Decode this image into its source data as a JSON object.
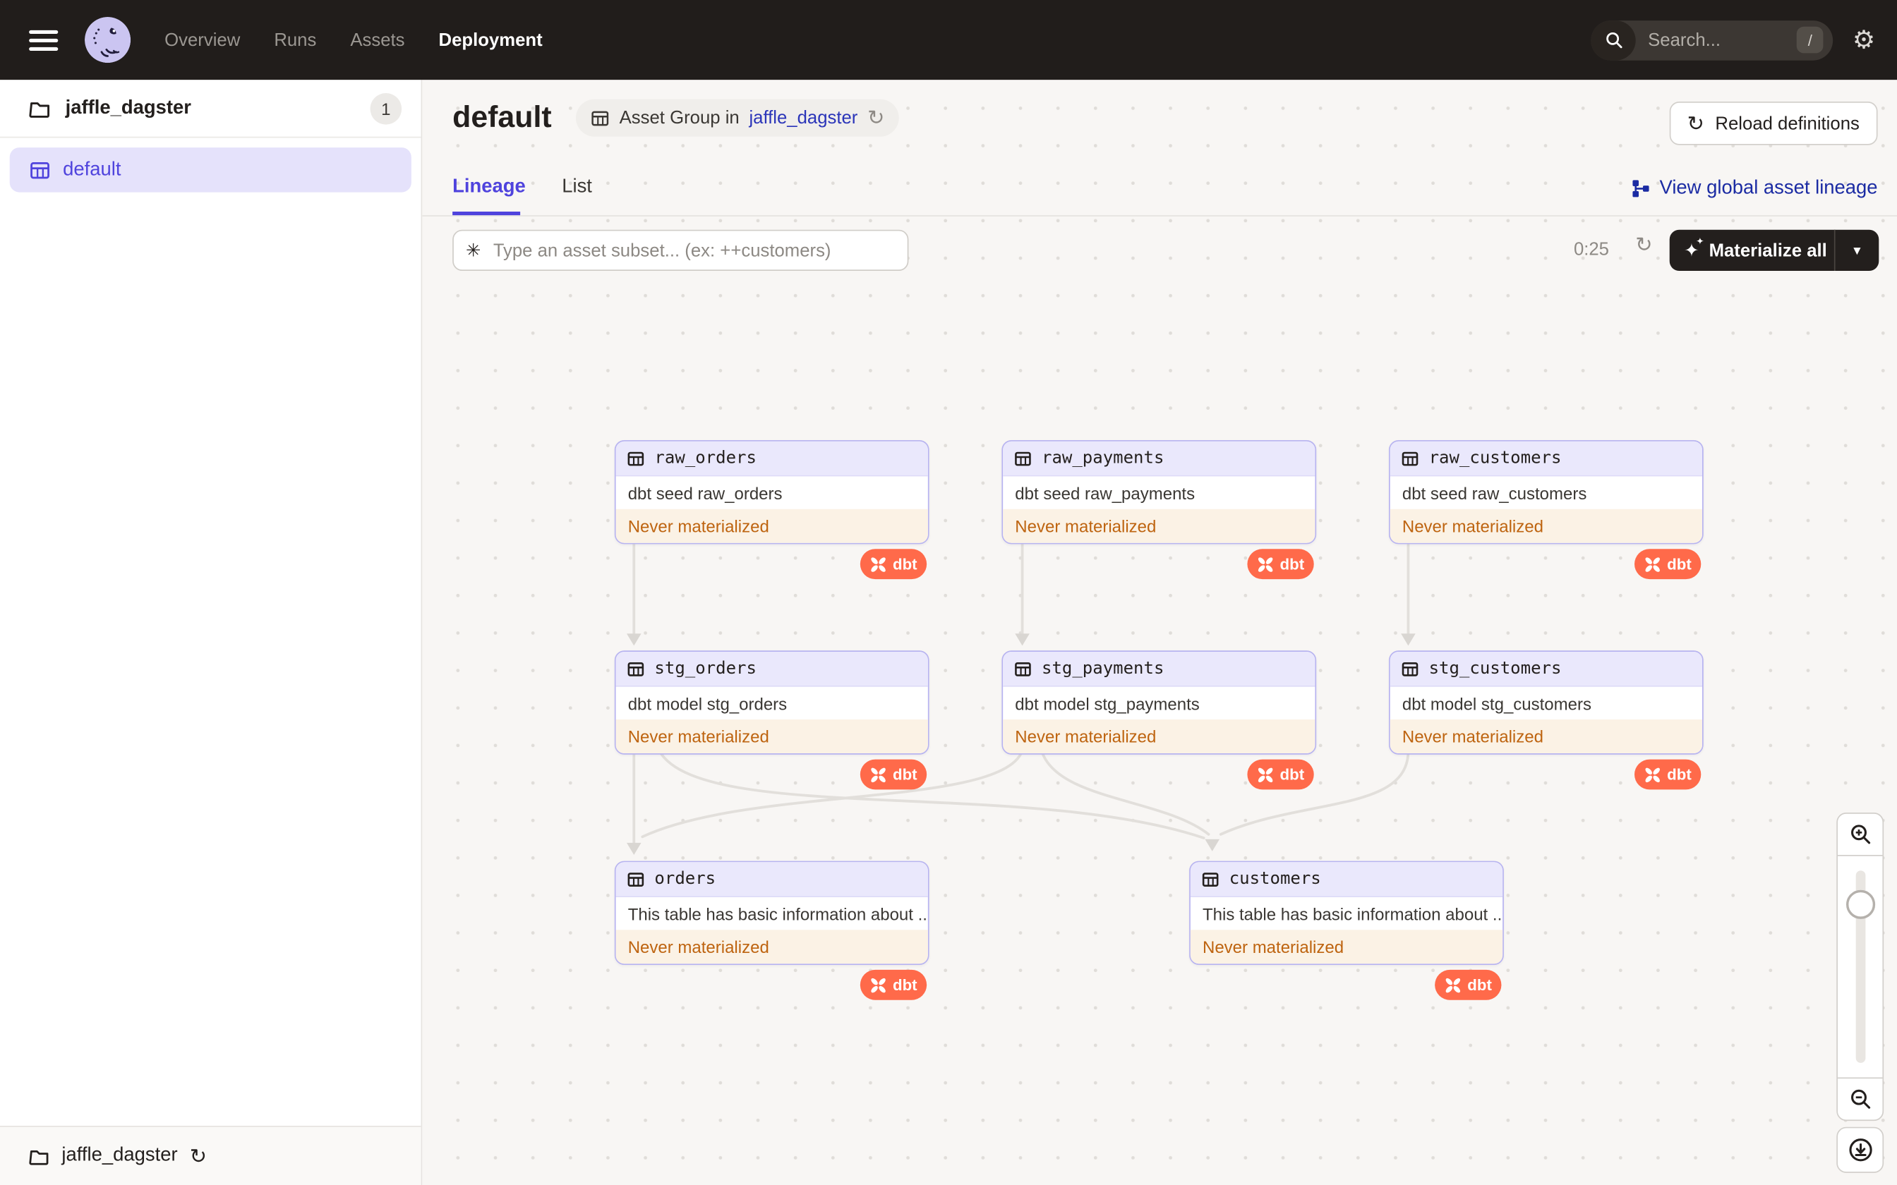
{
  "topbar": {
    "nav": [
      "Overview",
      "Runs",
      "Assets",
      "Deployment"
    ],
    "active_nav": "Deployment",
    "search": {
      "placeholder": "Search...",
      "shortcut": "/"
    }
  },
  "sidebar": {
    "project": {
      "name": "jaffle_dagster",
      "badge": "1"
    },
    "items": [
      {
        "label": "default",
        "selected": true
      }
    ],
    "footer": {
      "label": "jaffle_dagster"
    }
  },
  "header": {
    "title": "default",
    "group_badge": {
      "prefix": "Asset Group in",
      "link": "jaffle_dagster"
    },
    "reload_button": "Reload definitions"
  },
  "tabs": {
    "lineage": "Lineage",
    "list": "List"
  },
  "global_lineage_link": "View global asset lineage",
  "graph_toolbar": {
    "filter_placeholder": "Type an asset subset... (ex: ++customers)",
    "timer": "0:25",
    "materialize": "Materialize all"
  },
  "graph": {
    "nodes": [
      {
        "id": "raw_orders",
        "name": "raw_orders",
        "description": "dbt seed raw_orders",
        "status": "Never materialized",
        "badge": "dbt"
      },
      {
        "id": "raw_payments",
        "name": "raw_payments",
        "description": "dbt seed raw_payments",
        "status": "Never materialized",
        "badge": "dbt"
      },
      {
        "id": "raw_customers",
        "name": "raw_customers",
        "description": "dbt seed raw_customers",
        "status": "Never materialized",
        "badge": "dbt"
      },
      {
        "id": "stg_orders",
        "name": "stg_orders",
        "description": "dbt model stg_orders",
        "status": "Never materialized",
        "badge": "dbt"
      },
      {
        "id": "stg_payments",
        "name": "stg_payments",
        "description": "dbt model stg_payments",
        "status": "Never materialized",
        "badge": "dbt"
      },
      {
        "id": "stg_customers",
        "name": "stg_customers",
        "description": "dbt model stg_customers",
        "status": "Never materialized",
        "badge": "dbt"
      },
      {
        "id": "orders",
        "name": "orders",
        "description": "This table has basic information about ...",
        "status": "Never materialized",
        "badge": "dbt"
      },
      {
        "id": "customers",
        "name": "customers",
        "description": "This table has basic information about ...",
        "status": "Never materialized",
        "badge": "dbt"
      }
    ],
    "edges": [
      [
        "raw_orders",
        "stg_orders"
      ],
      [
        "raw_payments",
        "stg_payments"
      ],
      [
        "raw_customers",
        "stg_customers"
      ],
      [
        "stg_orders",
        "orders"
      ],
      [
        "stg_payments",
        "orders"
      ],
      [
        "stg_orders",
        "customers"
      ],
      [
        "stg_payments",
        "customers"
      ],
      [
        "stg_customers",
        "customers"
      ]
    ]
  },
  "icons": {
    "refresh_glyph": "↻",
    "caret_glyph": "▾",
    "sparkle_glyph": "✦",
    "filter_glyph": "✳"
  },
  "colors": {
    "topbar": "#211D1B",
    "accent_purple": "#4F43DD",
    "selected_bg": "#E5E2FB",
    "node_border": "#B7B3F0",
    "node_header": "#EAE8FC",
    "status_bg": "#FBF2E5",
    "status_text": "#BE6410",
    "dbt_orange": "#FF6A4A",
    "link_navy": "#1B2BA3",
    "canvas": "#F8F6F4"
  }
}
